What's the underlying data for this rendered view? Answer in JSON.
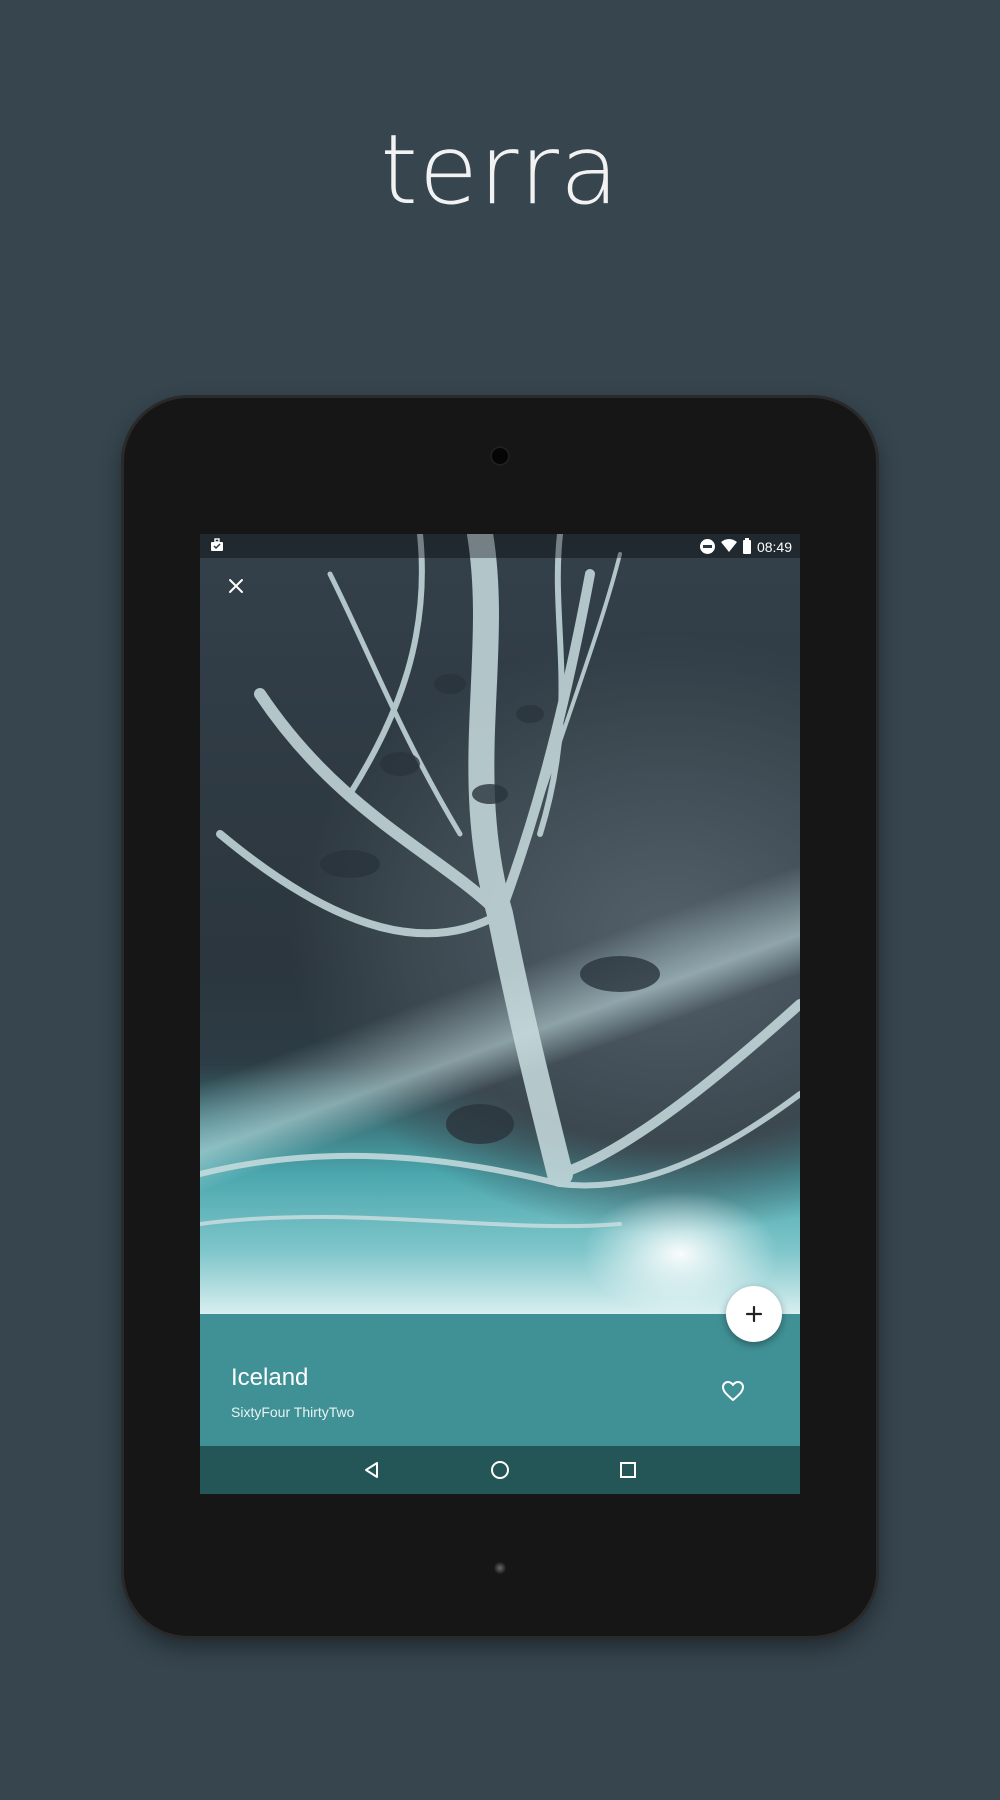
{
  "promo": {
    "app_title": "terra"
  },
  "status_bar": {
    "time": "08:49",
    "icons": [
      "work-profile-icon",
      "do-not-disturb-icon",
      "wifi-icon",
      "battery-icon"
    ]
  },
  "detail": {
    "title": "Iceland",
    "subtitle": "SixtyFour ThirtyTwo",
    "close_icon": "close-icon",
    "fab_icon": "plus-icon",
    "favorite_icon": "heart-outline-icon"
  },
  "nav_bar": {
    "buttons": [
      "back-icon",
      "home-icon",
      "recents-icon"
    ]
  },
  "colors": {
    "background": "#36454e",
    "panel": "#409196",
    "nav_bar": "#245658",
    "fab": "#ffffff"
  }
}
